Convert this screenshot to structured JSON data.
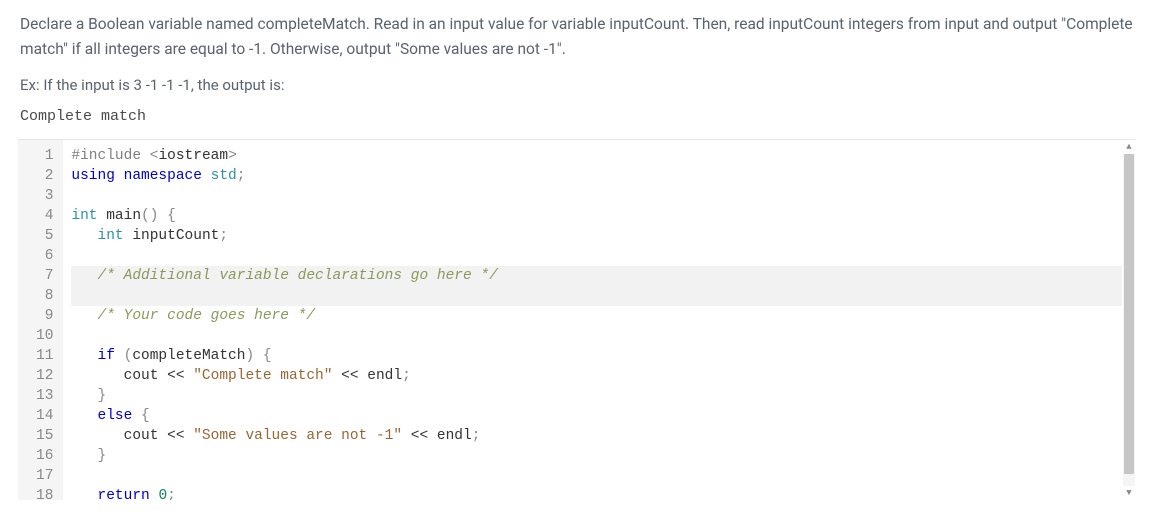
{
  "instructions": "Declare a Boolean variable named completeMatch. Read in an input value for variable inputCount. Then, read inputCount integers from input and output \"Complete match\" if all integers are equal to -1. Otherwise, output \"Some values are not -1\".",
  "example_intro": "Ex: If the input is 3 -1 -1 -1, the output is:",
  "example_output": "Complete match",
  "code": {
    "lines": [
      {
        "n": 1,
        "tokens": [
          [
            "pp",
            "#include "
          ],
          [
            "punc",
            "<"
          ],
          [
            "text",
            "iostream"
          ],
          [
            "punc",
            ">"
          ]
        ]
      },
      {
        "n": 2,
        "tokens": [
          [
            "keyword",
            "using"
          ],
          [
            "text",
            " "
          ],
          [
            "keyword",
            "namespace"
          ],
          [
            "text",
            " "
          ],
          [
            "ns",
            "std"
          ],
          [
            "punc",
            ";"
          ]
        ]
      },
      {
        "n": 3,
        "tokens": []
      },
      {
        "n": 4,
        "tokens": [
          [
            "type",
            "int"
          ],
          [
            "text",
            " "
          ],
          [
            "text",
            "main"
          ],
          [
            "punc",
            "()"
          ],
          [
            "text",
            " "
          ],
          [
            "punc",
            "{"
          ]
        ]
      },
      {
        "n": 5,
        "tokens": [
          [
            "text",
            "   "
          ],
          [
            "type",
            "int"
          ],
          [
            "text",
            " inputCount"
          ],
          [
            "punc",
            ";"
          ]
        ]
      },
      {
        "n": 6,
        "tokens": []
      },
      {
        "n": 7,
        "hl": true,
        "tokens": [
          [
            "text",
            "   "
          ],
          [
            "comment",
            "/* Additional variable declarations go here */"
          ]
        ]
      },
      {
        "n": 8,
        "hl": true,
        "tokens": []
      },
      {
        "n": 9,
        "tokens": [
          [
            "text",
            "   "
          ],
          [
            "comment",
            "/* Your code goes here */"
          ]
        ]
      },
      {
        "n": 10,
        "tokens": []
      },
      {
        "n": 11,
        "tokens": [
          [
            "text",
            "   "
          ],
          [
            "keyword",
            "if"
          ],
          [
            "text",
            " "
          ],
          [
            "punc",
            "("
          ],
          [
            "text",
            "completeMatch"
          ],
          [
            "punc",
            ")"
          ],
          [
            "text",
            " "
          ],
          [
            "punc",
            "{"
          ]
        ]
      },
      {
        "n": 12,
        "tokens": [
          [
            "text",
            "      cout "
          ],
          [
            "op",
            "<<"
          ],
          [
            "text",
            " "
          ],
          [
            "string",
            "\"Complete match\""
          ],
          [
            "text",
            " "
          ],
          [
            "op",
            "<<"
          ],
          [
            "text",
            " endl"
          ],
          [
            "punc",
            ";"
          ]
        ]
      },
      {
        "n": 13,
        "tokens": [
          [
            "text",
            "   "
          ],
          [
            "punc",
            "}"
          ]
        ]
      },
      {
        "n": 14,
        "tokens": [
          [
            "text",
            "   "
          ],
          [
            "keyword",
            "else"
          ],
          [
            "text",
            " "
          ],
          [
            "punc",
            "{"
          ]
        ]
      },
      {
        "n": 15,
        "tokens": [
          [
            "text",
            "      cout "
          ],
          [
            "op",
            "<<"
          ],
          [
            "text",
            " "
          ],
          [
            "string",
            "\"Some values are not -1\""
          ],
          [
            "text",
            " "
          ],
          [
            "op",
            "<<"
          ],
          [
            "text",
            " endl"
          ],
          [
            "punc",
            ";"
          ]
        ]
      },
      {
        "n": 16,
        "tokens": [
          [
            "text",
            "   "
          ],
          [
            "punc",
            "}"
          ]
        ]
      },
      {
        "n": 17,
        "tokens": []
      },
      {
        "n": 18,
        "tokens": [
          [
            "text",
            "   "
          ],
          [
            "keyword",
            "return"
          ],
          [
            "text",
            " "
          ],
          [
            "num",
            "0"
          ],
          [
            "punc",
            ";"
          ]
        ]
      }
    ]
  }
}
